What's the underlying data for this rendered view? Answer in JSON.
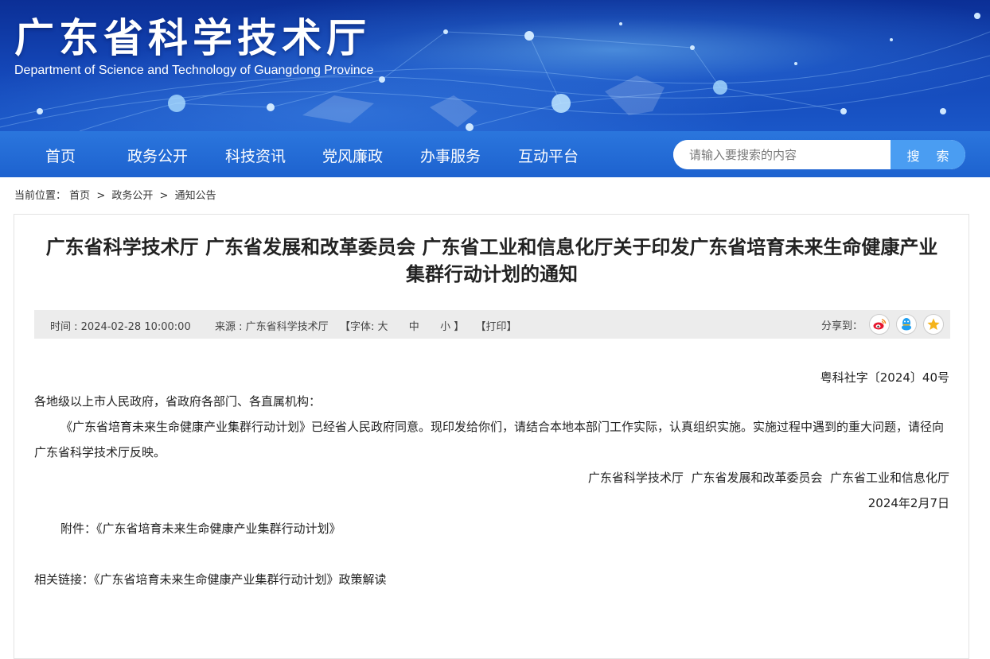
{
  "header": {
    "title": "广东省科学技术厅",
    "subtitle": "Department of Science and Technology of Guangdong Province"
  },
  "nav": {
    "items": [
      "首页",
      "政务公开",
      "科技资讯",
      "党风廉政",
      "办事服务",
      "互动平台"
    ]
  },
  "search": {
    "placeholder": "请输入要搜索的内容",
    "button_label": "搜 索"
  },
  "breadcrumb": {
    "prefix": "当前位置：",
    "items": [
      "首页",
      "政务公开",
      "通知公告"
    ],
    "separator": ">"
  },
  "article": {
    "title": "广东省科学技术厅 广东省发展和改革委员会 广东省工业和信息化厅关于印发广东省培育未来生命健康产业集群行动计划的通知",
    "meta": {
      "time_label": "时间 : ",
      "time": "2024-02-28 10:00:00",
      "source_label": "来源 : ",
      "source": "广东省科学技术厅",
      "font_label": "【字体: ",
      "font_large": "大",
      "font_medium": "中",
      "font_small": "小",
      "font_close": " 】",
      "print": "【打印】",
      "share_label": "分享到："
    },
    "share_icons": [
      "weibo-icon",
      "qq-icon",
      "qzone-icon"
    ],
    "doc_number": "粤科社字〔2024〕40号",
    "salutation": "各地级以上市人民政府，省政府各部门、各直属机构：",
    "body": "《广东省培育未来生命健康产业集群行动计划》已经省人民政府同意。现印发给你们，请结合本地本部门工作实际，认真组织实施。实施过程中遇到的重大问题，请径向广东省科学技术厅反映。",
    "issuers": "广东省科学技术厅  广东省发展和改革委员会  广东省工业和信息化厅",
    "date": "2024年2月7日",
    "attachment_label": "附件：",
    "attachment_link": "《广东省培育未来生命健康产业集群行动计划》",
    "related_label": "相关链接：",
    "related_link": "《广东省培育未来生命健康产业集群行动计划》政策解读"
  },
  "colors": {
    "banner_dark": "#0b2f96",
    "nav_blue": "#1d62cf",
    "search_button": "#4a9df2",
    "meta_bar": "#ececec",
    "weibo": "#e6162d",
    "qq": "#1e9ef0",
    "qzone": "#f5b41b"
  }
}
